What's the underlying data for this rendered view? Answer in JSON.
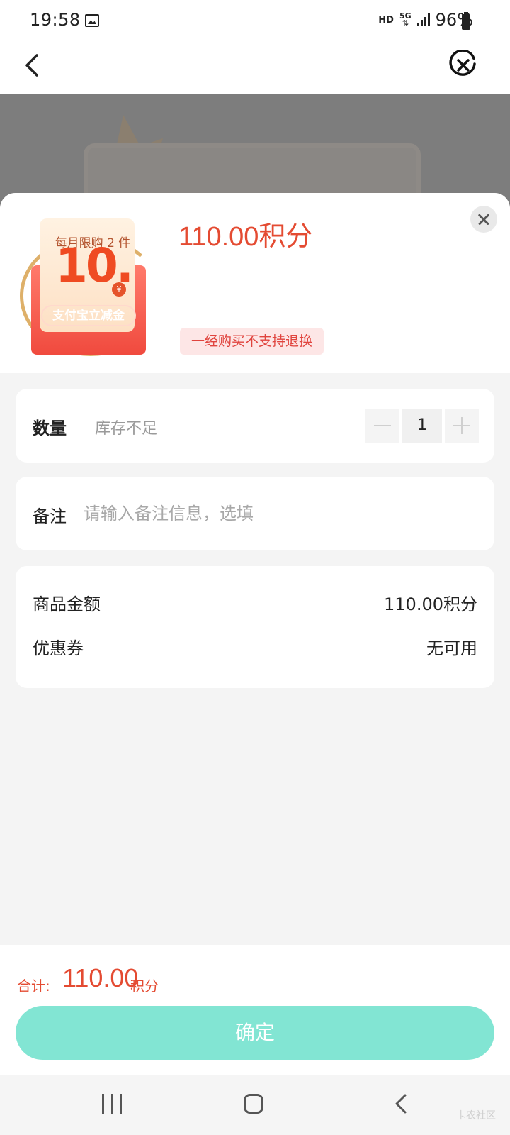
{
  "status_bar": {
    "time": "19:58",
    "hd": "HD",
    "network": "5G",
    "battery": "96%"
  },
  "product": {
    "thumb_limit_text": "每月限购 2 件",
    "thumb_amount": "10.",
    "thumb_currency": "¥",
    "thumb_pill": "支付宝立减金",
    "price": "110.00积分",
    "refund_notice": "一经购买不支持退换"
  },
  "quantity": {
    "label": "数量",
    "stock_status": "库存不足",
    "value": "1"
  },
  "note": {
    "label": "备注",
    "placeholder": "请输入备注信息，选填"
  },
  "summary": {
    "goods_amount_label": "商品金额",
    "goods_amount_value": "110.00积分",
    "coupon_label": "优惠券",
    "coupon_value": "无可用"
  },
  "footer": {
    "total_label": "合计:",
    "total_value": "110.00",
    "total_unit": "积分",
    "confirm_label": "确定"
  },
  "watermark": "卡农社区",
  "colors": {
    "accent_red": "#e44b32",
    "confirm_teal": "#82e5d3",
    "refund_tag_bg": "#fde6e6"
  }
}
